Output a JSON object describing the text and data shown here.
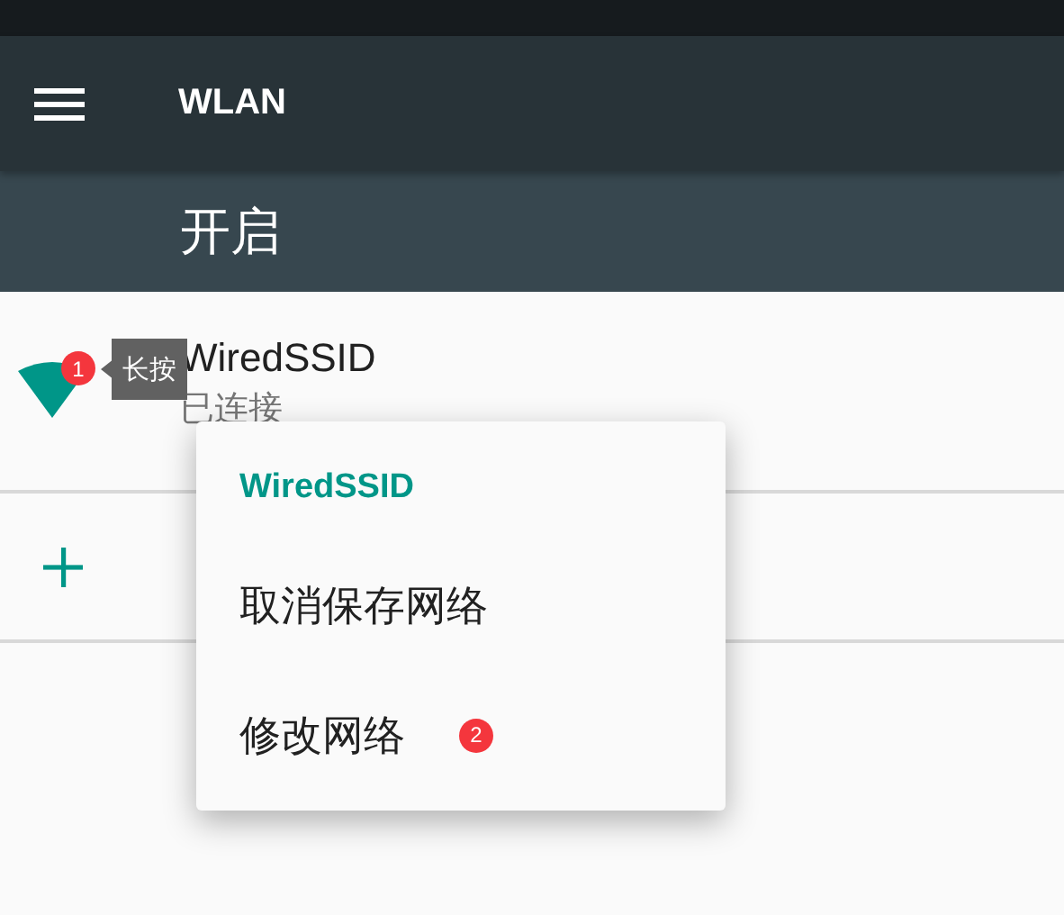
{
  "toolbar": {
    "title": "WLAN"
  },
  "switch_bar": {
    "label": "开启"
  },
  "networks": [
    {
      "kind": "wifi",
      "name": "WiredSSID",
      "status": "已连接",
      "badge": "1",
      "tooltip": "长按"
    },
    {
      "kind": "add"
    }
  ],
  "context_menu": {
    "title": "WiredSSID",
    "items": [
      {
        "label": "取消保存网络"
      },
      {
        "label": "修改网络",
        "badge": "2"
      }
    ]
  }
}
